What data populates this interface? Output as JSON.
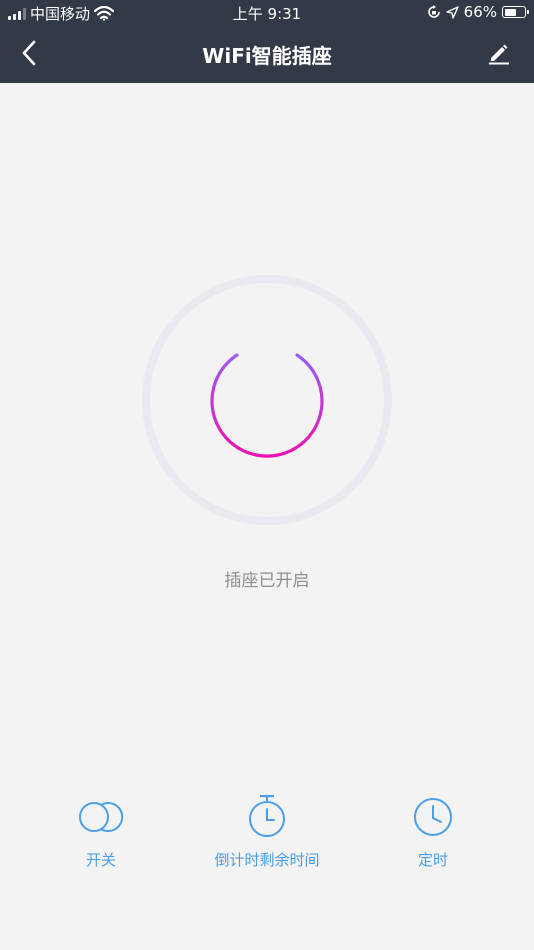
{
  "status_bar": {
    "carrier": "中国移动",
    "time": "上午 9:31",
    "battery": "66%",
    "battery_level": 0.66,
    "icons": [
      "signal-icon",
      "wifi-icon",
      "rotation-lock-icon",
      "location-icon",
      "battery-icon"
    ]
  },
  "navbar": {
    "title": "WiFi智能插座",
    "back_icon": "chevron-left-icon",
    "edit_icon": "pencil-icon"
  },
  "power": {
    "state_text": "插座已开启",
    "is_on": true,
    "icon": "power-icon",
    "gradient_start": "#9b5cf5",
    "gradient_end": "#ee0fb4",
    "ring_color": "#e9e9f0"
  },
  "actions": [
    {
      "label": "开关",
      "icon": "toggle-circles-icon"
    },
    {
      "label": "倒计时剩余时间",
      "icon": "stopwatch-icon"
    },
    {
      "label": "定时",
      "icon": "clock-icon"
    }
  ],
  "colors": {
    "header_bg": "#323a47",
    "page_bg": "#f3f3f3",
    "accent": "#4a9fe8",
    "state_text": "#8f8f8f"
  }
}
